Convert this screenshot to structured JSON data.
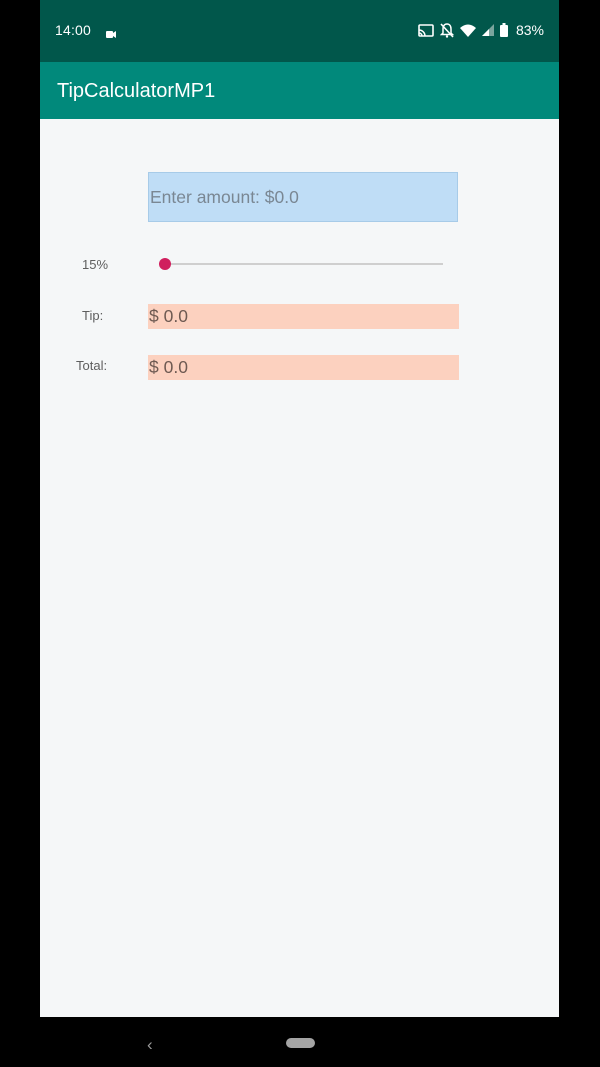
{
  "status_bar": {
    "time": "14:00",
    "battery": "83%",
    "icons": [
      "video-camera-icon",
      "cast-icon",
      "notifications-off-icon",
      "wifi-icon",
      "signal-icon",
      "battery-icon"
    ]
  },
  "app_bar": {
    "title": "TipCalculatorMP1",
    "color": "#01897b"
  },
  "form": {
    "amount_placeholder": "Enter amount: $0.0",
    "tip_percent": "15%",
    "slider_value_fraction": 0.0,
    "tip_label": "Tip:",
    "tip_value": "$ 0.0",
    "total_label": "Total:",
    "total_value": "$ 0.0"
  },
  "colors": {
    "status_bar": "#01574b",
    "accent": "#d01f5e",
    "input_bg": "#bfddf6",
    "result_bg": "#fcd1bf"
  },
  "nav": {
    "icons": [
      "back-icon",
      "home-pill-icon"
    ]
  }
}
